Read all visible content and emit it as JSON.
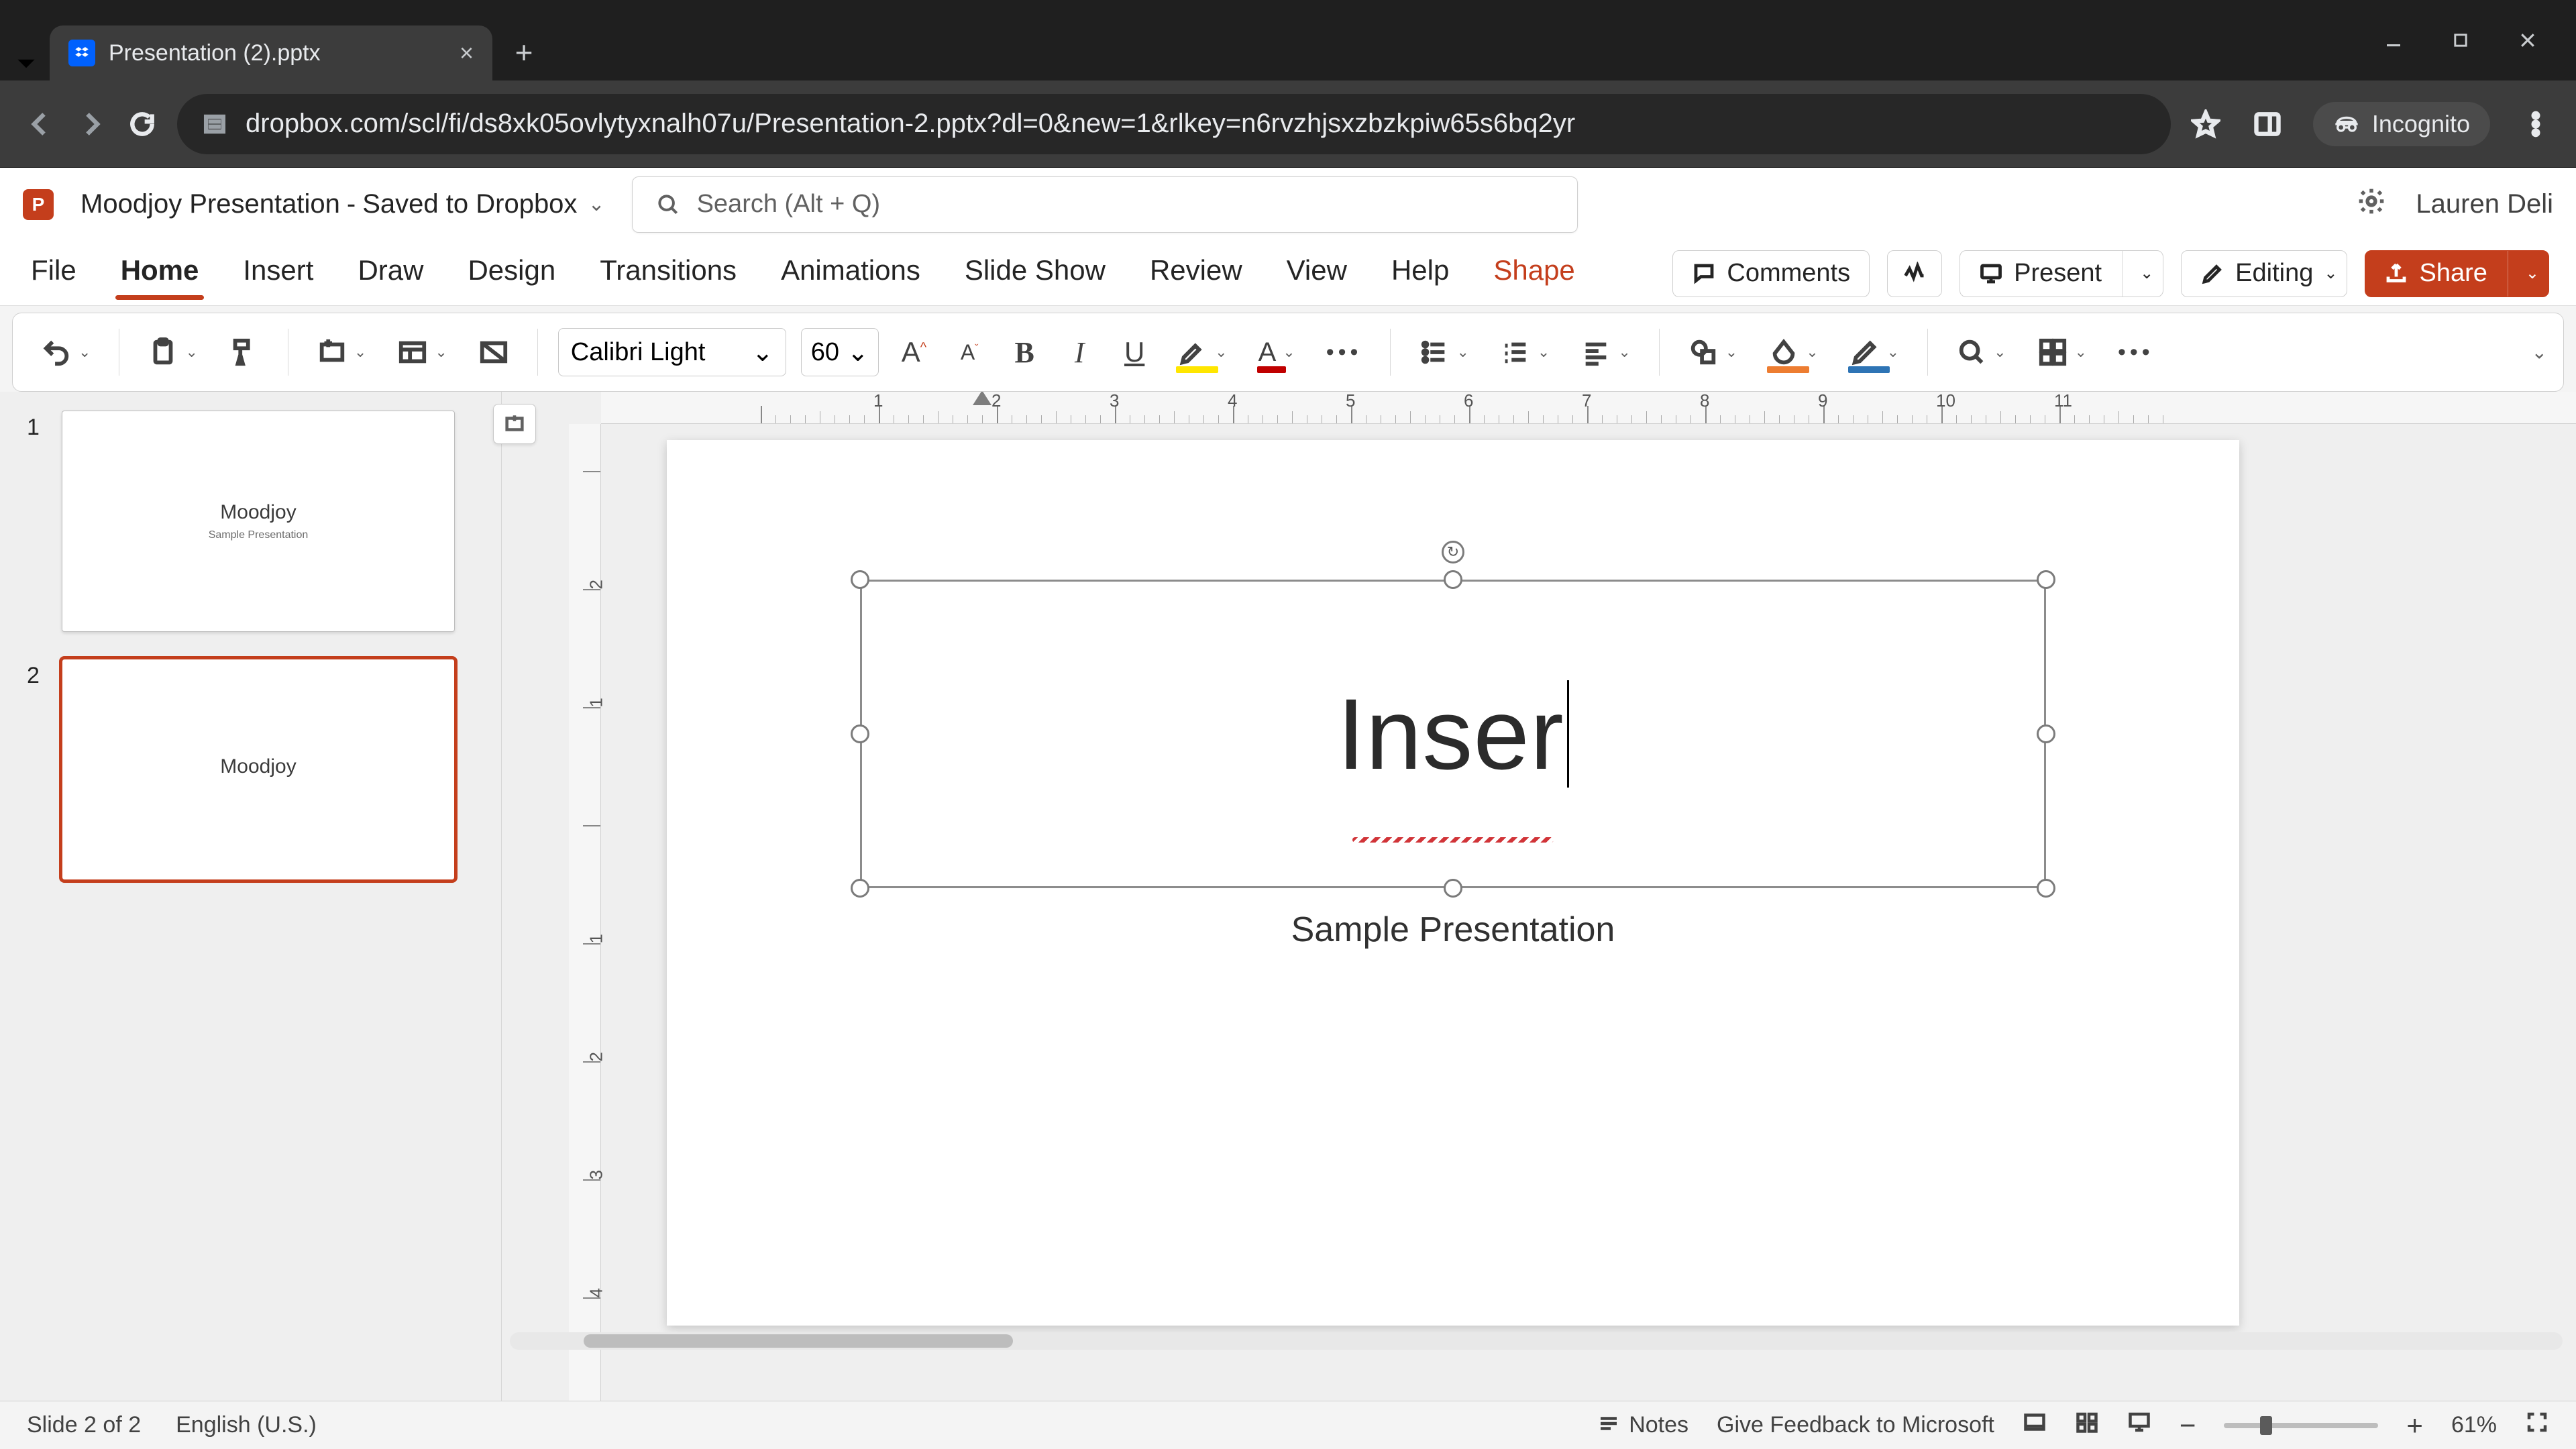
{
  "browser": {
    "tab_title": "Presentation (2).pptx",
    "url": "dropbox.com/scl/fi/ds8xk05ovlytyxnalh07u/Presentation-2.pptx?dl=0&new=1&rlkey=n6rvzhjsxzbzkpiw65s6bq2yr",
    "incognito_label": "Incognito"
  },
  "header": {
    "app_initial": "P",
    "doc_title": "Moodjoy Presentation",
    "save_state": "Saved to Dropbox",
    "search_placeholder": "Search (Alt + Q)",
    "user_name": "Lauren Deli"
  },
  "ribbon": {
    "tabs": [
      "File",
      "Home",
      "Insert",
      "Draw",
      "Design",
      "Transitions",
      "Animations",
      "Slide Show",
      "Review",
      "View",
      "Help",
      "Shape"
    ],
    "active_tab": "Home",
    "contextual_tab": "Shape",
    "right": {
      "comments": "Comments",
      "present": "Present",
      "editing": "Editing",
      "share": "Share"
    }
  },
  "toolbar": {
    "font_name": "Calibri Light",
    "font_size": "60",
    "highlight_color": "#ffe600",
    "font_color": "#c00000",
    "shape_fill_color": "#ed7d31",
    "shape_outline_color": "#2e74b5"
  },
  "ruler": {
    "h_labels": [
      "",
      "1",
      "2",
      "3",
      "4",
      "5",
      "6",
      "7",
      "8",
      "9",
      "10",
      "11"
    ],
    "v_labels": [
      "",
      "2",
      "1",
      "",
      "1",
      "2",
      "3",
      "4"
    ]
  },
  "thumbnails": [
    {
      "num": "1",
      "title": "Moodjoy",
      "subtitle": "Sample Presentation",
      "selected": false
    },
    {
      "num": "2",
      "title": "Moodjoy",
      "subtitle": "",
      "selected": true
    }
  ],
  "slide": {
    "title_text": "Inser",
    "subtitle_text": "Sample Presentation"
  },
  "status": {
    "slide_pos": "Slide 2 of 2",
    "language": "English (U.S.)",
    "notes": "Notes",
    "feedback": "Give Feedback to Microsoft",
    "zoom": "61%"
  }
}
